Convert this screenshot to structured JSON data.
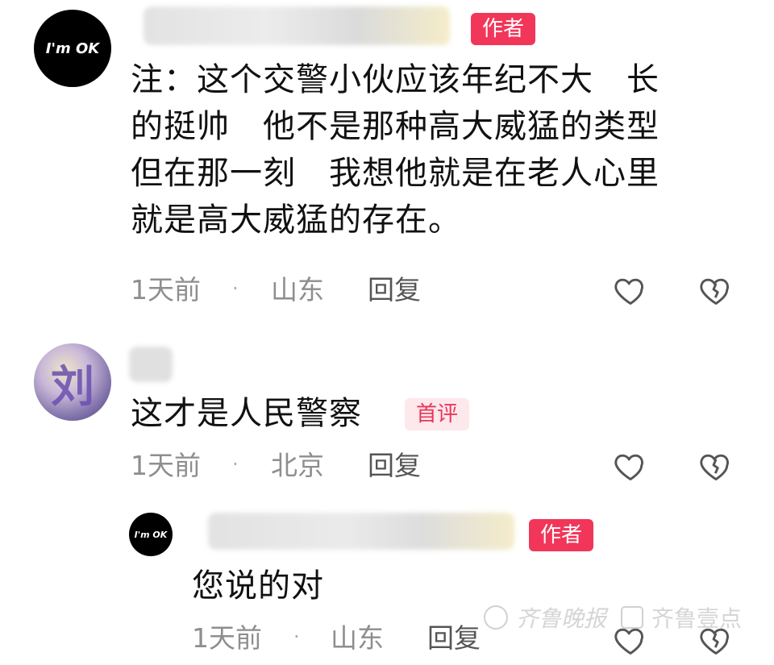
{
  "comments": [
    {
      "avatar_text": "I'm OK",
      "author_badge": "作者",
      "lines": [
        "注：这个交警小伙应该年纪不大　长",
        "的挺帅　他不是那种高大威猛的类型",
        "但在那一刻　我想他就是在老人心里",
        "就是高大威猛的存在。"
      ],
      "time": "1天前",
      "location": "山东",
      "reply_label": "回复"
    },
    {
      "avatar_text": "刘",
      "text": "这才是人民警察",
      "badge": "首评",
      "time": "1天前",
      "location": "北京",
      "reply_label": "回复"
    }
  ],
  "reply": {
    "avatar_text": "I'm OK",
    "author_badge": "作者",
    "text": "您说的对",
    "time": "1天前",
    "location": "山东",
    "reply_label": "回复"
  },
  "separator": "·",
  "watermark": {
    "left": "齐鲁晚报",
    "right": "齐鲁壹点"
  },
  "colors": {
    "author_badge_bg": "#f2365a",
    "first_badge_bg": "#fde8ec",
    "meta_text": "#8e8e8e"
  }
}
